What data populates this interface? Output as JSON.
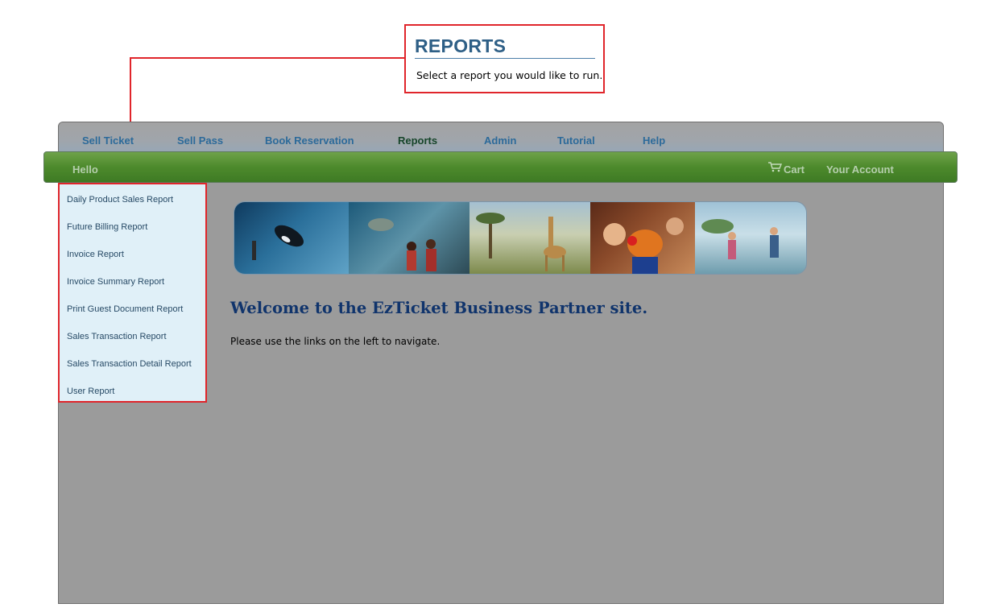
{
  "callout": {
    "title": "REPORTS",
    "text": "Select a report you would like to run."
  },
  "nav": {
    "items": [
      {
        "label": "Sell Ticket"
      },
      {
        "label": "Sell Pass"
      },
      {
        "label": "Book Reservation"
      },
      {
        "label": "Reports",
        "active": true
      },
      {
        "label": "Admin"
      },
      {
        "label": "Tutorial"
      },
      {
        "label": "Help"
      }
    ]
  },
  "greenbar": {
    "greeting": "Hello",
    "cart_label": "Cart",
    "account_label": "Your Account"
  },
  "menu": {
    "items": [
      {
        "label": "Daily Product Sales Report"
      },
      {
        "label": "Future Billing Report"
      },
      {
        "label": "Invoice Report"
      },
      {
        "label": "Invoice Summary Report"
      },
      {
        "label": "Print Guest Document Report"
      },
      {
        "label": "Sales Transaction Report"
      },
      {
        "label": "Sales Transaction Detail Report"
      },
      {
        "label": "User Report"
      }
    ]
  },
  "main": {
    "welcome": "Welcome to the EzTicket Business Partner site.",
    "instructions": "Please use the links on the left to navigate."
  },
  "colors": {
    "callout_border": "#e0252b",
    "title_blue": "#2e5f86",
    "nav_link": "#2c6a9a",
    "nav_active": "#16452a",
    "green_bar": "#4d8a2c",
    "menu_bg": "#e0f0f8",
    "frame_bg": "#9b9b9b",
    "welcome_text": "#10346c"
  },
  "icons": {
    "cart": "cart-icon"
  }
}
